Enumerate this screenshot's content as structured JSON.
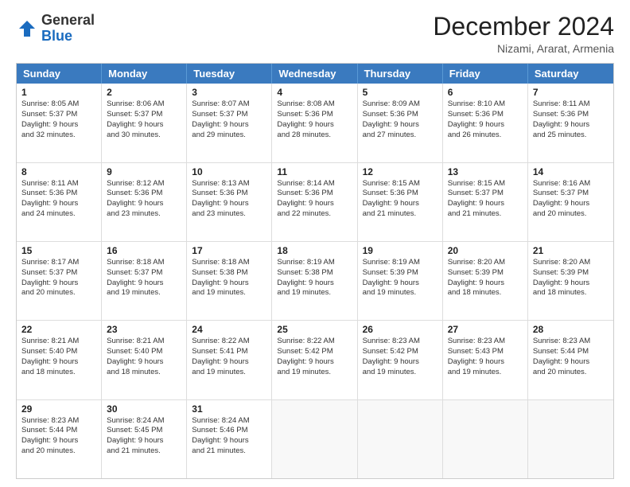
{
  "header": {
    "logo_general": "General",
    "logo_blue": "Blue",
    "month_title": "December 2024",
    "location": "Nizami, Ararat, Armenia"
  },
  "weekdays": [
    "Sunday",
    "Monday",
    "Tuesday",
    "Wednesday",
    "Thursday",
    "Friday",
    "Saturday"
  ],
  "weeks": [
    [
      {
        "day": "1",
        "lines": [
          "Sunrise: 8:05 AM",
          "Sunset: 5:37 PM",
          "Daylight: 9 hours",
          "and 32 minutes."
        ]
      },
      {
        "day": "2",
        "lines": [
          "Sunrise: 8:06 AM",
          "Sunset: 5:37 PM",
          "Daylight: 9 hours",
          "and 30 minutes."
        ]
      },
      {
        "day": "3",
        "lines": [
          "Sunrise: 8:07 AM",
          "Sunset: 5:37 PM",
          "Daylight: 9 hours",
          "and 29 minutes."
        ]
      },
      {
        "day": "4",
        "lines": [
          "Sunrise: 8:08 AM",
          "Sunset: 5:36 PM",
          "Daylight: 9 hours",
          "and 28 minutes."
        ]
      },
      {
        "day": "5",
        "lines": [
          "Sunrise: 8:09 AM",
          "Sunset: 5:36 PM",
          "Daylight: 9 hours",
          "and 27 minutes."
        ]
      },
      {
        "day": "6",
        "lines": [
          "Sunrise: 8:10 AM",
          "Sunset: 5:36 PM",
          "Daylight: 9 hours",
          "and 26 minutes."
        ]
      },
      {
        "day": "7",
        "lines": [
          "Sunrise: 8:11 AM",
          "Sunset: 5:36 PM",
          "Daylight: 9 hours",
          "and 25 minutes."
        ]
      }
    ],
    [
      {
        "day": "8",
        "lines": [
          "Sunrise: 8:11 AM",
          "Sunset: 5:36 PM",
          "Daylight: 9 hours",
          "and 24 minutes."
        ]
      },
      {
        "day": "9",
        "lines": [
          "Sunrise: 8:12 AM",
          "Sunset: 5:36 PM",
          "Daylight: 9 hours",
          "and 23 minutes."
        ]
      },
      {
        "day": "10",
        "lines": [
          "Sunrise: 8:13 AM",
          "Sunset: 5:36 PM",
          "Daylight: 9 hours",
          "and 23 minutes."
        ]
      },
      {
        "day": "11",
        "lines": [
          "Sunrise: 8:14 AM",
          "Sunset: 5:36 PM",
          "Daylight: 9 hours",
          "and 22 minutes."
        ]
      },
      {
        "day": "12",
        "lines": [
          "Sunrise: 8:15 AM",
          "Sunset: 5:36 PM",
          "Daylight: 9 hours",
          "and 21 minutes."
        ]
      },
      {
        "day": "13",
        "lines": [
          "Sunrise: 8:15 AM",
          "Sunset: 5:37 PM",
          "Daylight: 9 hours",
          "and 21 minutes."
        ]
      },
      {
        "day": "14",
        "lines": [
          "Sunrise: 8:16 AM",
          "Sunset: 5:37 PM",
          "Daylight: 9 hours",
          "and 20 minutes."
        ]
      }
    ],
    [
      {
        "day": "15",
        "lines": [
          "Sunrise: 8:17 AM",
          "Sunset: 5:37 PM",
          "Daylight: 9 hours",
          "and 20 minutes."
        ]
      },
      {
        "day": "16",
        "lines": [
          "Sunrise: 8:18 AM",
          "Sunset: 5:37 PM",
          "Daylight: 9 hours",
          "and 19 minutes."
        ]
      },
      {
        "day": "17",
        "lines": [
          "Sunrise: 8:18 AM",
          "Sunset: 5:38 PM",
          "Daylight: 9 hours",
          "and 19 minutes."
        ]
      },
      {
        "day": "18",
        "lines": [
          "Sunrise: 8:19 AM",
          "Sunset: 5:38 PM",
          "Daylight: 9 hours",
          "and 19 minutes."
        ]
      },
      {
        "day": "19",
        "lines": [
          "Sunrise: 8:19 AM",
          "Sunset: 5:39 PM",
          "Daylight: 9 hours",
          "and 19 minutes."
        ]
      },
      {
        "day": "20",
        "lines": [
          "Sunrise: 8:20 AM",
          "Sunset: 5:39 PM",
          "Daylight: 9 hours",
          "and 18 minutes."
        ]
      },
      {
        "day": "21",
        "lines": [
          "Sunrise: 8:20 AM",
          "Sunset: 5:39 PM",
          "Daylight: 9 hours",
          "and 18 minutes."
        ]
      }
    ],
    [
      {
        "day": "22",
        "lines": [
          "Sunrise: 8:21 AM",
          "Sunset: 5:40 PM",
          "Daylight: 9 hours",
          "and 18 minutes."
        ]
      },
      {
        "day": "23",
        "lines": [
          "Sunrise: 8:21 AM",
          "Sunset: 5:40 PM",
          "Daylight: 9 hours",
          "and 18 minutes."
        ]
      },
      {
        "day": "24",
        "lines": [
          "Sunrise: 8:22 AM",
          "Sunset: 5:41 PM",
          "Daylight: 9 hours",
          "and 19 minutes."
        ]
      },
      {
        "day": "25",
        "lines": [
          "Sunrise: 8:22 AM",
          "Sunset: 5:42 PM",
          "Daylight: 9 hours",
          "and 19 minutes."
        ]
      },
      {
        "day": "26",
        "lines": [
          "Sunrise: 8:23 AM",
          "Sunset: 5:42 PM",
          "Daylight: 9 hours",
          "and 19 minutes."
        ]
      },
      {
        "day": "27",
        "lines": [
          "Sunrise: 8:23 AM",
          "Sunset: 5:43 PM",
          "Daylight: 9 hours",
          "and 19 minutes."
        ]
      },
      {
        "day": "28",
        "lines": [
          "Sunrise: 8:23 AM",
          "Sunset: 5:44 PM",
          "Daylight: 9 hours",
          "and 20 minutes."
        ]
      }
    ],
    [
      {
        "day": "29",
        "lines": [
          "Sunrise: 8:23 AM",
          "Sunset: 5:44 PM",
          "Daylight: 9 hours",
          "and 20 minutes."
        ]
      },
      {
        "day": "30",
        "lines": [
          "Sunrise: 8:24 AM",
          "Sunset: 5:45 PM",
          "Daylight: 9 hours",
          "and 21 minutes."
        ]
      },
      {
        "day": "31",
        "lines": [
          "Sunrise: 8:24 AM",
          "Sunset: 5:46 PM",
          "Daylight: 9 hours",
          "and 21 minutes."
        ]
      },
      {
        "day": "",
        "lines": []
      },
      {
        "day": "",
        "lines": []
      },
      {
        "day": "",
        "lines": []
      },
      {
        "day": "",
        "lines": []
      }
    ]
  ]
}
